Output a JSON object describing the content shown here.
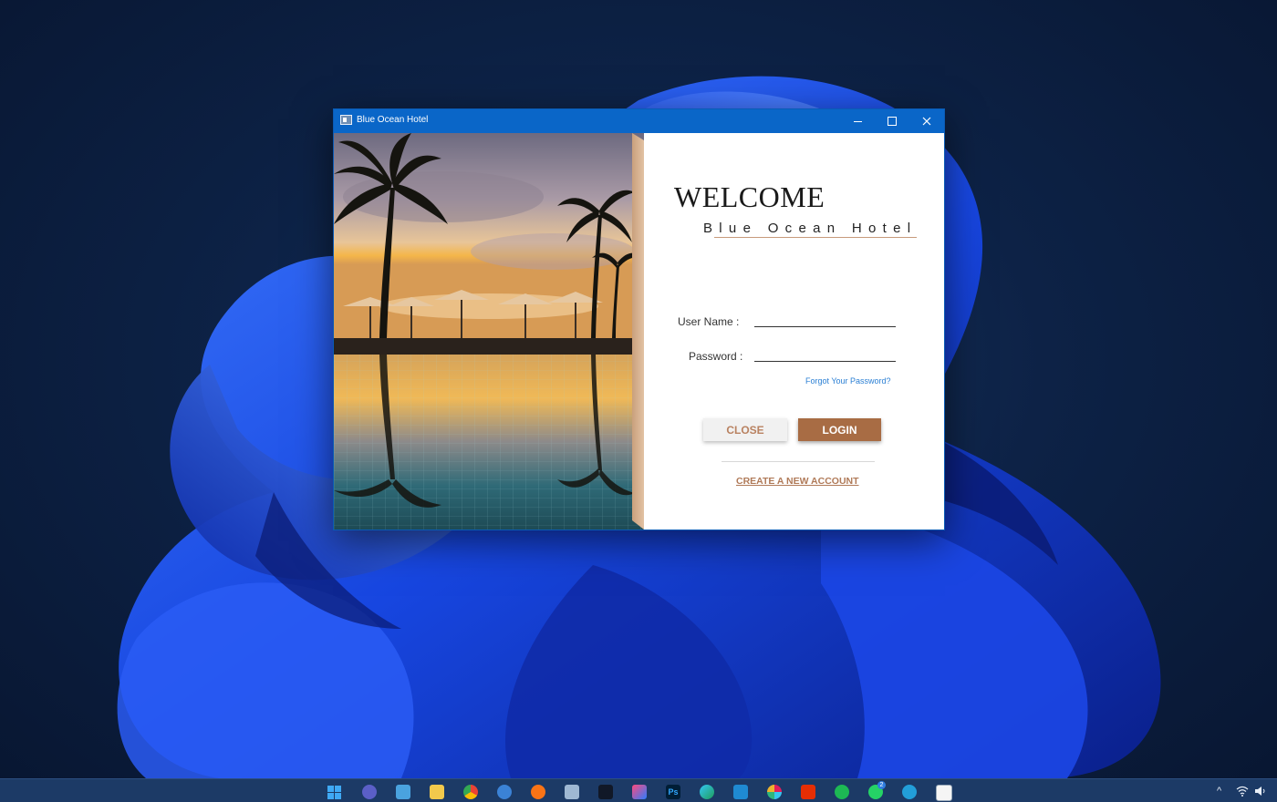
{
  "window": {
    "title": "Blue Ocean Hotel"
  },
  "login": {
    "welcome": "WELCOME",
    "hotel_name": "Blue Ocean Hotel",
    "username_label": "User Name :",
    "password_label": "Password :",
    "username_value": "",
    "password_value": "",
    "forgot_link": "Forgot Your Password?",
    "close_button": "CLOSE",
    "login_button": "LOGIN",
    "create_account_link": "CREATE A NEW ACCOUNT"
  },
  "colors": {
    "titlebar": "#0a66c8",
    "accent_brown": "#a86c44",
    "link_blue": "#2a7fd4",
    "taskbar": "#1c3a66"
  },
  "taskbar": {
    "icons": [
      "windows-start-icon",
      "teams-icon",
      "desktop-icon",
      "file-explorer-icon",
      "chrome-icon",
      "snipping-icon",
      "firefox-icon",
      "package-icon",
      "terminal-icon",
      "intellij-icon",
      "photoshop-icon",
      "edge-icon",
      "vscode-icon",
      "slack-icon",
      "aliexpress-icon",
      "spotify-icon",
      "whatsapp-icon",
      "telegram-icon",
      "java-app-icon"
    ],
    "whatsapp_badge": "2",
    "tray": {
      "chevron": "^",
      "photoshop_label": "Ps"
    }
  }
}
